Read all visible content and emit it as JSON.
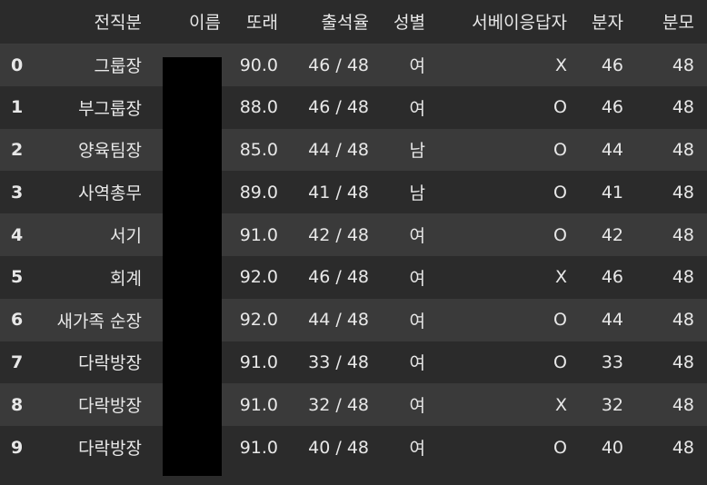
{
  "columns": [
    "",
    "전직분",
    "이름",
    "또래",
    "출석율",
    "성별",
    "서베이응답자",
    "분자",
    "분모"
  ],
  "rows": [
    {
      "idx": "0",
      "role": "그룹장",
      "name": "",
      "score": "90.0",
      "attendance": "46 / 48",
      "sex": "여",
      "survey": "X",
      "numerator": "46",
      "denominator": "48"
    },
    {
      "idx": "1",
      "role": "부그룹장",
      "name": "",
      "score": "88.0",
      "attendance": "46 / 48",
      "sex": "여",
      "survey": "O",
      "numerator": "46",
      "denominator": "48"
    },
    {
      "idx": "2",
      "role": "양육팀장",
      "name": "",
      "score": "85.0",
      "attendance": "44 / 48",
      "sex": "남",
      "survey": "O",
      "numerator": "44",
      "denominator": "48"
    },
    {
      "idx": "3",
      "role": "사역총무",
      "name": "",
      "score": "89.0",
      "attendance": "41 / 48",
      "sex": "남",
      "survey": "O",
      "numerator": "41",
      "denominator": "48"
    },
    {
      "idx": "4",
      "role": "서기",
      "name": "",
      "score": "91.0",
      "attendance": "42 / 48",
      "sex": "여",
      "survey": "O",
      "numerator": "42",
      "denominator": "48"
    },
    {
      "idx": "5",
      "role": "회계",
      "name": "",
      "score": "92.0",
      "attendance": "46 / 48",
      "sex": "여",
      "survey": "X",
      "numerator": "46",
      "denominator": "48"
    },
    {
      "idx": "6",
      "role": "새가족 순장",
      "name": "",
      "score": "92.0",
      "attendance": "44 / 48",
      "sex": "여",
      "survey": "O",
      "numerator": "44",
      "denominator": "48"
    },
    {
      "idx": "7",
      "role": "다락방장",
      "name": "",
      "score": "91.0",
      "attendance": "33 / 48",
      "sex": "여",
      "survey": "O",
      "numerator": "33",
      "denominator": "48"
    },
    {
      "idx": "8",
      "role": "다락방장",
      "name": "",
      "score": "91.0",
      "attendance": "32 / 48",
      "sex": "여",
      "survey": "X",
      "numerator": "32",
      "denominator": "48"
    },
    {
      "idx": "9",
      "role": "다락방장",
      "name": "",
      "score": "91.0",
      "attendance": "40 / 48",
      "sex": "여",
      "survey": "O",
      "numerator": "40",
      "denominator": "48"
    }
  ],
  "colors": {
    "background": "#2b2b2b",
    "row_stripe": "#3a3a3a",
    "text": "#e8e8e8",
    "redaction": "#000000"
  }
}
